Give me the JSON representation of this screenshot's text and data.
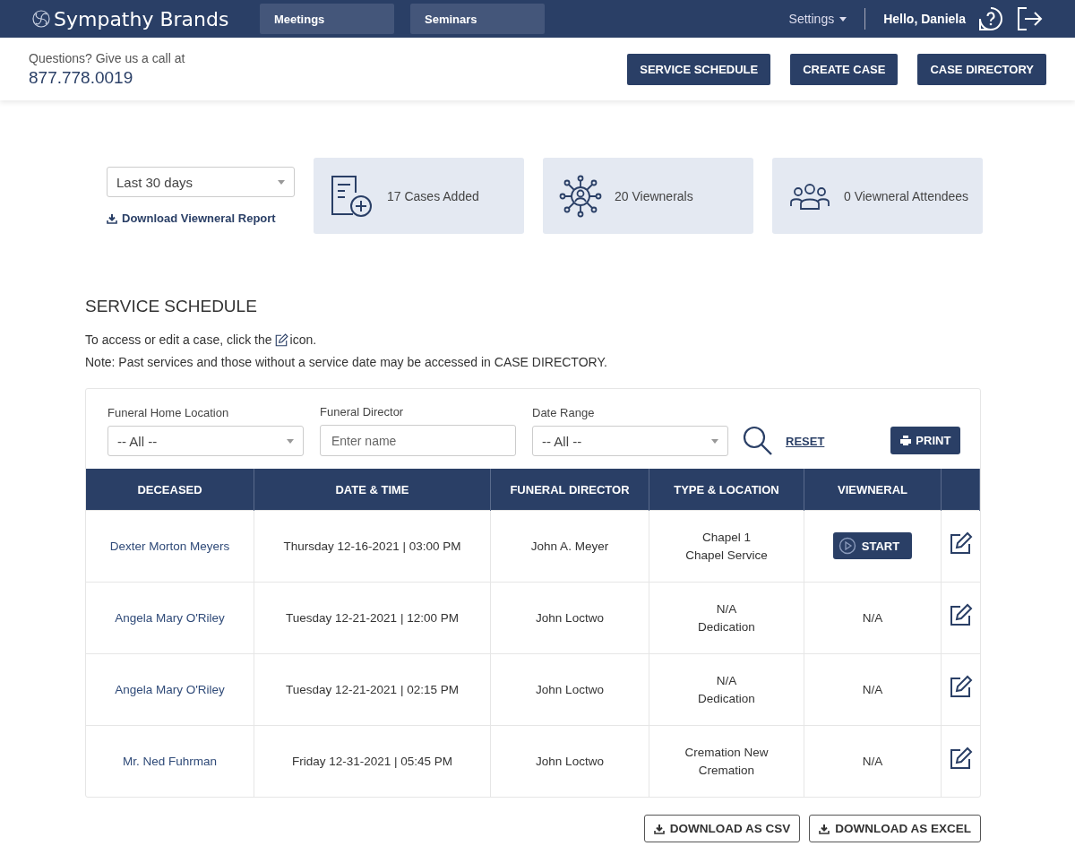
{
  "nav": {
    "brand": "Sympathy Brands",
    "tabs": [
      {
        "label": "Meetings"
      },
      {
        "label": "Seminars"
      }
    ],
    "settings": "Settings",
    "greeting": "Hello, Daniela"
  },
  "contact": {
    "prompt": "Questions? Give us a call at",
    "phone": "877.778.0019"
  },
  "actions": [
    "SERVICE SCHEDULE",
    "CREATE CASE",
    "CASE DIRECTORY"
  ],
  "period": {
    "value": "Last 30 days"
  },
  "report_link": "Download Viewneral Report",
  "stats": [
    {
      "kind": "cases",
      "label": "17 Cases Added"
    },
    {
      "kind": "viewnerals",
      "label": "20 Viewnerals"
    },
    {
      "kind": "attendees",
      "label": "0 Viewneral Attendees"
    }
  ],
  "schedule": {
    "title": "SERVICE SCHEDULE",
    "hint_before": "To access or edit a case, click the",
    "hint_after": "icon.",
    "note": "Note: Past services and those without a service date may be accessed in CASE DIRECTORY."
  },
  "filters": {
    "location": {
      "label": "Funeral Home Location",
      "value": "-- All --"
    },
    "director": {
      "label": "Funeral Director",
      "placeholder": "Enter name"
    },
    "date_range": {
      "label": "Date Range",
      "value": "-- All --"
    },
    "reset": "RESET",
    "print": "PRINT"
  },
  "table": {
    "columns": [
      "DECEASED",
      "DATE & TIME",
      "FUNERAL DIRECTOR",
      "TYPE & LOCATION",
      "VIEWNERAL"
    ],
    "rows": [
      {
        "deceased": "Dexter Morton Meyers",
        "datetime": "Thursday 12-16-2021 | 03:00 PM",
        "director": "John A. Meyer",
        "type": "Chapel 1",
        "location": "Chapel Service",
        "viewneral": {
          "kind": "button",
          "text": "START"
        }
      },
      {
        "deceased": "Angela Mary O'Riley",
        "datetime": "Tuesday 12-21-2021 | 12:00 PM",
        "director": "John Loctwo",
        "type": "N/A",
        "location": "Dedication",
        "viewneral": {
          "kind": "text",
          "text": "N/A"
        }
      },
      {
        "deceased": "Angela Mary O'Riley",
        "datetime": "Tuesday 12-21-2021 | 02:15 PM",
        "director": "John Loctwo",
        "type": "N/A",
        "location": "Dedication",
        "viewneral": {
          "kind": "text",
          "text": "N/A"
        }
      },
      {
        "deceased": "Mr. Ned Fuhrman",
        "datetime": "Friday 12-31-2021 | 05:45 PM",
        "director": "John Loctwo",
        "type": "Cremation New",
        "location": "Cremation",
        "viewneral": {
          "kind": "text",
          "text": "N/A"
        }
      }
    ]
  },
  "downloads": [
    "DOWNLOAD AS CSV",
    "DOWNLOAD AS EXCEL"
  ]
}
